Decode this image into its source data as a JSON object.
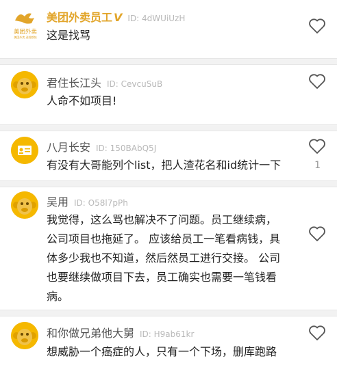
{
  "comments": [
    {
      "name": "美团外卖员工",
      "verified_mark": "V",
      "id_text": "ID: 4dWUiUzH",
      "avatar": "meituan-logo",
      "avatar_text": "美团外卖",
      "avatar_subtext": "美团外卖 送啥都快",
      "body": "这是找骂",
      "likes": ""
    },
    {
      "name": "君住长江头",
      "id_text": "ID: CevcuSuB",
      "avatar": "monkey-avatar",
      "body": "人命不如项目!",
      "likes": ""
    },
    {
      "name": "八月长安",
      "id_text": "ID: 150BAbQ5J",
      "avatar": "id-card-avatar",
      "body": "有没有大哥能列个list，把人渣花名和id统计一下",
      "likes": "1"
    },
    {
      "name": "吴用",
      "id_text": "ID: O58l7pPh",
      "avatar": "monkey-avatar",
      "body_lines": [
        "我觉得，这么骂也解决不了问题。员工继续病，",
        "公司项目也拖延了。 应该给员工一笔看病钱，具",
        "体多少我也不知道，然后然员工进行交接。 公司",
        "也要继续做项目下去，员工确实也需要一笔钱看",
        "病。"
      ],
      "likes": ""
    },
    {
      "name": "和你做兄弟他大舅",
      "id_text": "ID: H9ab61kr",
      "avatar": "monkey-avatar",
      "body": "想威胁一个癌症的人，只有一个下场，删库跑路",
      "likes": ""
    }
  ],
  "colors": {
    "vip_name": "#e2a52a",
    "avatar_yellow": "#f5b800",
    "monkey_face": "#f0c24a"
  },
  "icons": [
    "heart-icon",
    "meituan-logo",
    "monkey-avatar",
    "id-card-avatar"
  ]
}
